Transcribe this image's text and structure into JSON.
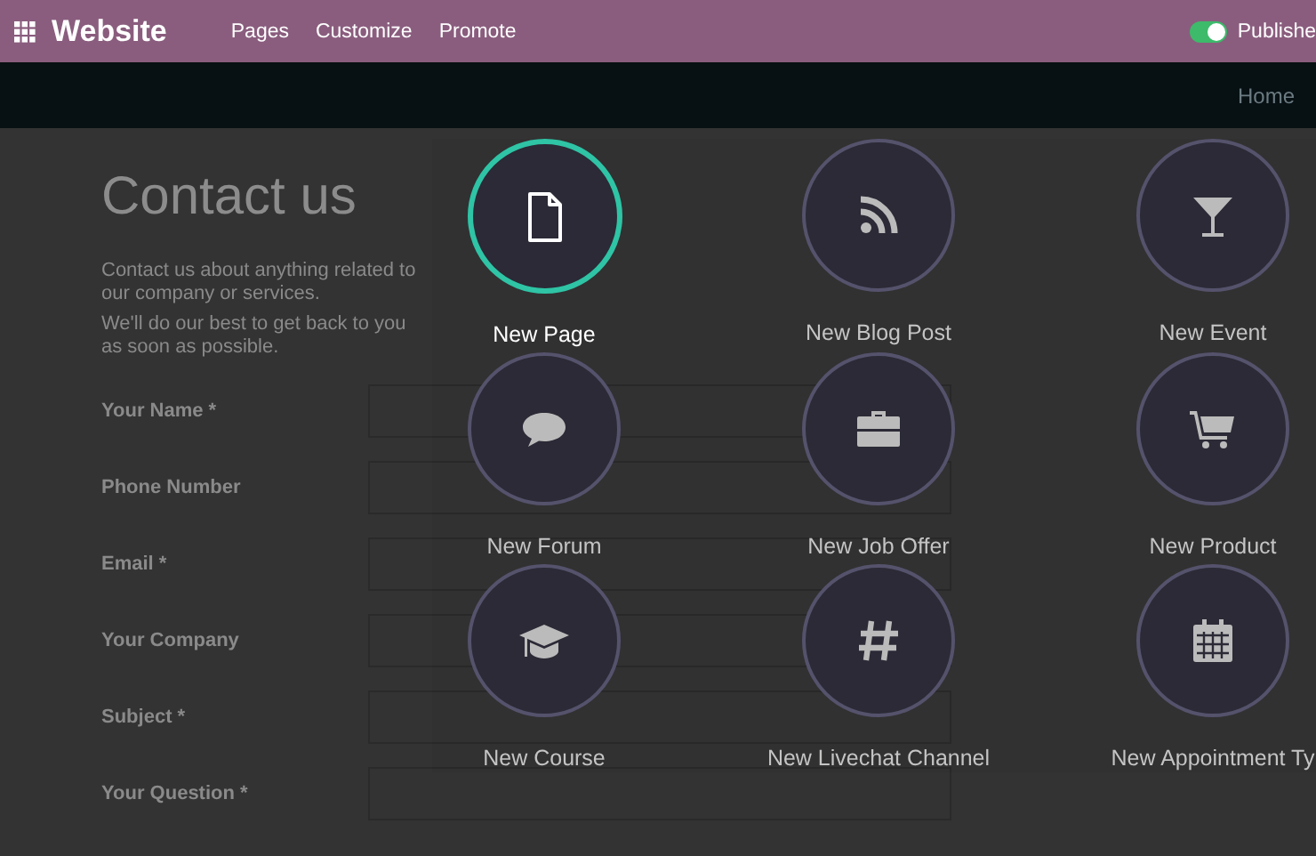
{
  "topbar": {
    "app_name": "Website",
    "menu": [
      "Pages",
      "Customize",
      "Promote"
    ],
    "publish": {
      "label": "Publishe",
      "on": true
    }
  },
  "site_nav": {
    "links": [
      "Home"
    ]
  },
  "page": {
    "title": "Contact us",
    "intro": [
      "Contact us about anything related to our company or services.",
      "We'll do our best to get back to you as soon as possible."
    ],
    "form_fields": [
      "Your Name *",
      "Phone Number",
      "Email *",
      "Your Company",
      "Subject *",
      "Your Question *"
    ]
  },
  "new_content": [
    {
      "kind": "page",
      "label": "New Page",
      "selected": true
    },
    {
      "kind": "rss",
      "label": "New Blog Post",
      "selected": false
    },
    {
      "kind": "glass",
      "label": "New Event",
      "selected": false
    },
    {
      "kind": "chat",
      "label": "New Forum",
      "selected": false
    },
    {
      "kind": "briefcase",
      "label": "New Job Offer",
      "selected": false
    },
    {
      "kind": "cart",
      "label": "New Product",
      "selected": false
    },
    {
      "kind": "cap",
      "label": "New Course",
      "selected": false
    },
    {
      "kind": "hash",
      "label": "New Livechat Channel",
      "selected": false
    },
    {
      "kind": "calendar",
      "label": "New Appointment Ty",
      "selected": false
    }
  ]
}
